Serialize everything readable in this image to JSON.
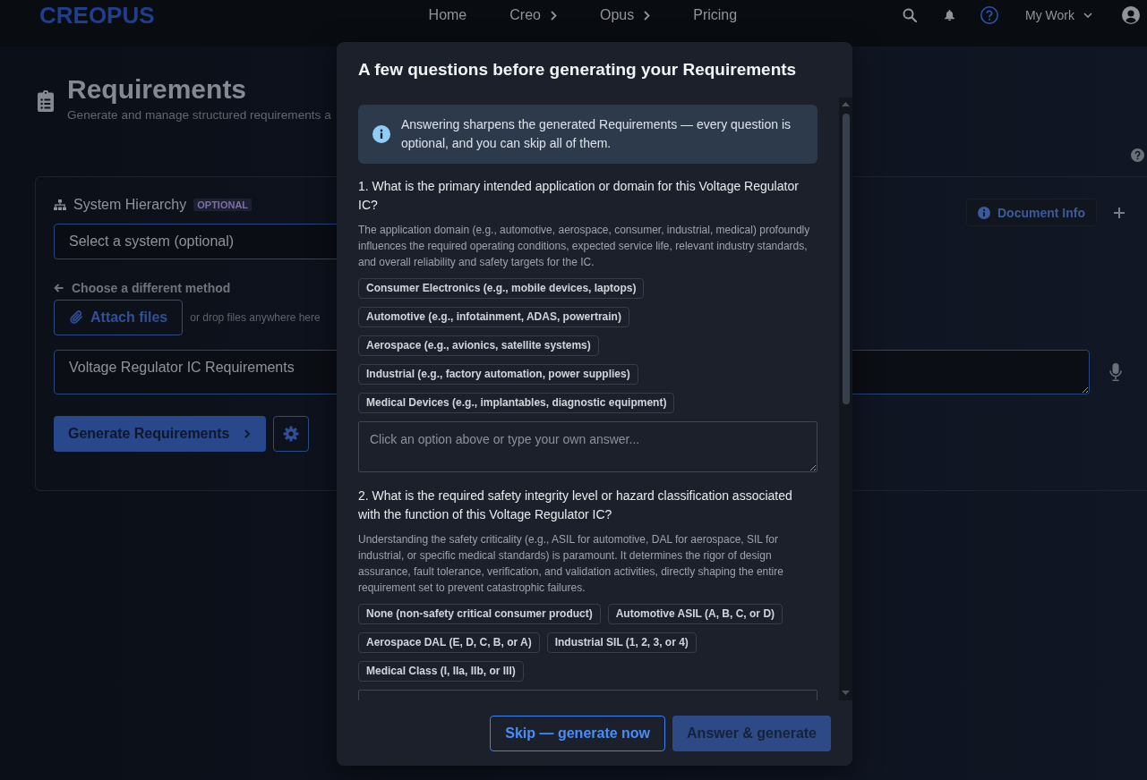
{
  "nav": {
    "logo": "CREOPUS",
    "links": [
      {
        "label": "Home",
        "has_menu": false
      },
      {
        "label": "Creo",
        "has_menu": true
      },
      {
        "label": "Opus",
        "has_menu": true
      },
      {
        "label": "Pricing",
        "has_menu": false
      }
    ],
    "account": "My Work"
  },
  "page_header": {
    "title": "Requirements",
    "subtitle": "Generate and manage structured requirements a"
  },
  "card": {
    "hierarchy": {
      "label": "System Hierarchy",
      "badge": "OPTIONAL",
      "placeholder": "Select a system (optional)"
    },
    "document_info": "Document Info",
    "back_link": "Choose a different method",
    "attach": {
      "button": "Attach files",
      "hint": "or drop files anywhere here"
    },
    "prompt": {
      "value": "Voltage Regulator IC Requirements"
    },
    "generate_button": "Generate Requirements"
  },
  "dialog": {
    "title": "A few questions before generating your Requirements",
    "notice": "Answering sharpens the generated Requirements — every question is optional, and you can skip all of them.",
    "questions": [
      {
        "text": "1. What is the primary intended application or domain for this Voltage Regulator IC?",
        "description": "The application domain (e.g., automotive, aerospace, consumer, industrial, medical) profoundly influences the required operating conditions, expected service life, relevant industry standards, and overall reliability and safety targets for the IC.",
        "options": [
          "Consumer Electronics (e.g., mobile devices, laptops)",
          "Automotive (e.g., infotainment, ADAS, powertrain)",
          "Aerospace (e.g., avionics, satellite systems)",
          "Industrial (e.g., factory automation, power supplies)",
          "Medical Devices (e.g., implantables, diagnostic equipment)"
        ],
        "answer_placeholder": "Click an option above or type your own answer..."
      },
      {
        "text": "2. What is the required safety integrity level or hazard classification associated with the function of this Voltage Regulator IC?",
        "description": "Understanding the safety criticality (e.g., ASIL for automotive, DAL for aerospace, SIL for industrial, or specific medical standards) is paramount. It determines the rigor of design assurance, fault tolerance, verification, and validation activities, directly shaping the entire requirement set to prevent catastrophic failures.",
        "options": [
          "None (non-safety critical consumer product)",
          "Automotive ASIL (A, B, C, or D)",
          "Aerospace DAL (E, D, C, B, or A)",
          "Industrial SIL (1, 2, 3, or 4)",
          "Medical Class (I, IIa, IIb, or III)"
        ]
      }
    ],
    "buttons": [
      {
        "label": "Skip — generate now",
        "kind": "outline"
      },
      {
        "label": "Answer & generate",
        "kind": "filled"
      }
    ]
  }
}
